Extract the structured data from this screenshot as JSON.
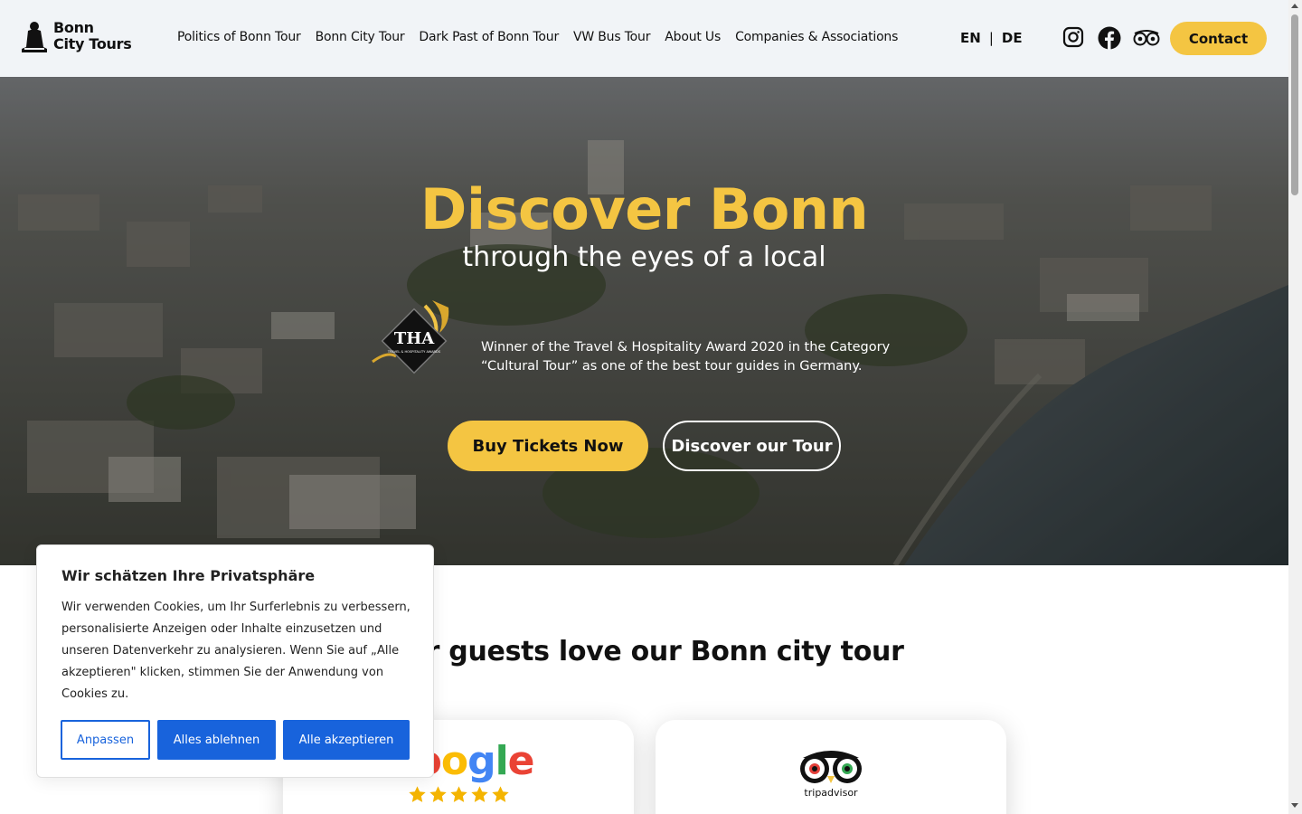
{
  "header": {
    "logo_line1": "Bonn",
    "logo_line2": "City Tours",
    "nav": [
      {
        "label": "Politics of Bonn Tour"
      },
      {
        "label": "Bonn City Tour"
      },
      {
        "label": "Dark Past of Bonn Tour"
      },
      {
        "label": "VW Bus Tour"
      },
      {
        "label": "About Us"
      },
      {
        "label": "Companies & Associations"
      }
    ],
    "lang_en": "EN",
    "lang_sep": "|",
    "lang_de": "DE",
    "social_icons": [
      "instagram-icon",
      "facebook-icon",
      "tripadvisor-icon"
    ],
    "contact_label": "Contact"
  },
  "hero": {
    "title": "Discover Bonn",
    "subtitle": "through the eyes of a local",
    "award_badge_text": "THA",
    "award_badge_small": "TRAVEL & HOSPITALITY AWARDS",
    "award_text": "Winner of the Travel & Hospitality Award 2020 in the Category “Cultural Tour”  as one of the best tour guides in Germany.",
    "buy_label": "Buy Tickets Now",
    "discover_label": "Discover our Tour"
  },
  "reviews": {
    "title": "Our guests love our Bonn city tour",
    "google_word": "Google",
    "google_stars": 5,
    "trip_label": "tripadvisor"
  },
  "cookie": {
    "title": "Wir schätzen Ihre Privatsphäre",
    "body": "Wir verwenden Cookies, um Ihr Surferlebnis zu verbessern, personalisierte Anzeigen oder Inhalte einzusetzen und unseren Datenverkehr zu analysieren. Wenn Sie auf „Alle akzeptieren\" klicken, stimmen Sie der Anwendung von Cookies zu.",
    "customize_label": "Anpassen",
    "reject_label": "Alles ablehnen",
    "accept_label": "Alle akzeptieren"
  },
  "colors": {
    "accent": "#f4c542",
    "header_bg": "#f1f4f7",
    "cookie_blue": "#1863dc"
  }
}
